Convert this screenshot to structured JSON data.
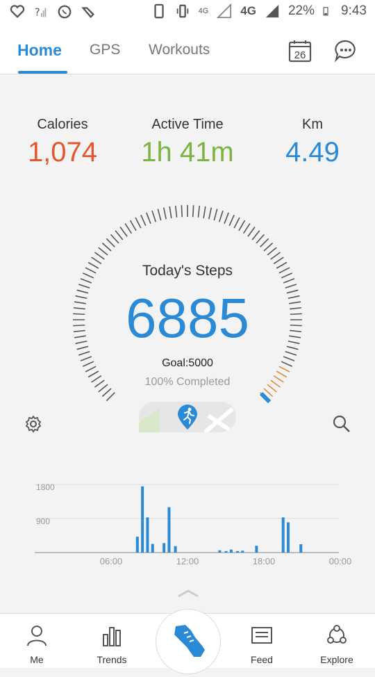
{
  "status_bar": {
    "battery": "22%",
    "time": "9:43",
    "network": "4G",
    "network_small": "4G"
  },
  "tabs": [
    {
      "label": "Home"
    },
    {
      "label": "GPS"
    },
    {
      "label": "Workouts"
    }
  ],
  "calendar_day": "26",
  "metrics": {
    "calories": {
      "label": "Calories",
      "value": "1,074"
    },
    "active_time": {
      "label": "Active Time",
      "value": "1h 41m"
    },
    "km": {
      "label": "Km",
      "value": "4.49"
    }
  },
  "steps": {
    "title": "Today's Steps",
    "value": "6885",
    "goal": "Goal:5000",
    "completed": "100% Completed",
    "progress": 1.0
  },
  "colors": {
    "accent": "#2b8ad6",
    "calories": "#e4572e",
    "active_time": "#7cb342",
    "km": "#2b8ad6"
  },
  "chart_data": {
    "type": "bar",
    "ylim": [
      0,
      1800
    ],
    "yticks": [
      "1800",
      "900"
    ],
    "xticks": [
      "06:00",
      "12:00",
      "18:00",
      "00:00"
    ],
    "series": [
      {
        "values": [
          {
            "t": 8.1,
            "v": 420
          },
          {
            "t": 8.5,
            "v": 1750
          },
          {
            "t": 8.9,
            "v": 930
          },
          {
            "t": 9.3,
            "v": 230
          },
          {
            "t": 10.2,
            "v": 250
          },
          {
            "t": 10.6,
            "v": 1200
          },
          {
            "t": 11.1,
            "v": 170
          },
          {
            "t": 14.6,
            "v": 60
          },
          {
            "t": 15.1,
            "v": 40
          },
          {
            "t": 15.5,
            "v": 80
          },
          {
            "t": 16.0,
            "v": 40
          },
          {
            "t": 16.4,
            "v": 50
          },
          {
            "t": 17.5,
            "v": 180
          },
          {
            "t": 19.6,
            "v": 930
          },
          {
            "t": 20.0,
            "v": 800
          },
          {
            "t": 21.0,
            "v": 220
          }
        ]
      }
    ]
  },
  "bottom_nav": [
    {
      "label": "Me"
    },
    {
      "label": "Trends"
    },
    {
      "label": "Feed"
    },
    {
      "label": "Explore"
    }
  ]
}
